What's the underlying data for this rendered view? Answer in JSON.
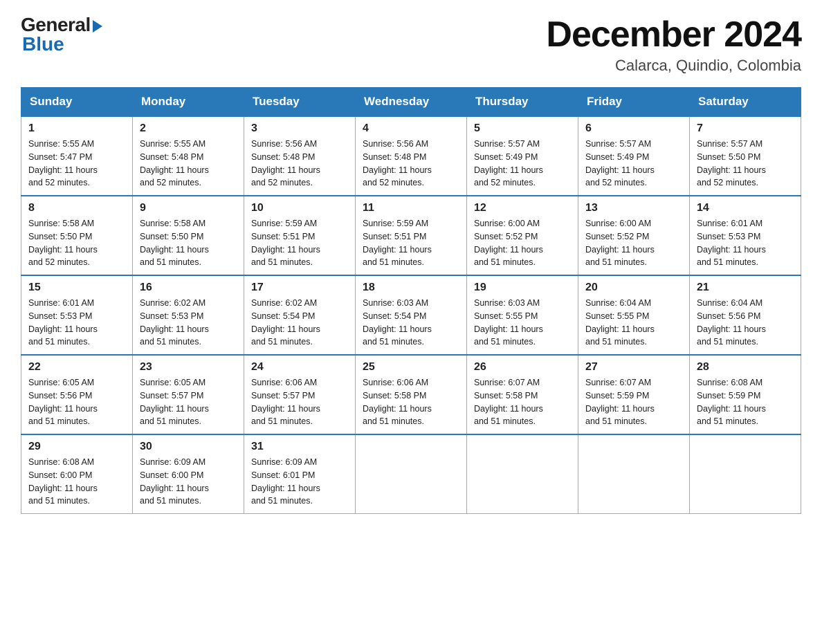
{
  "logo": {
    "general": "General",
    "blue": "Blue"
  },
  "title": {
    "month_year": "December 2024",
    "location": "Calarca, Quindio, Colombia"
  },
  "days_of_week": [
    "Sunday",
    "Monday",
    "Tuesday",
    "Wednesday",
    "Thursday",
    "Friday",
    "Saturday"
  ],
  "weeks": [
    [
      {
        "day": "1",
        "sunrise": "5:55 AM",
        "sunset": "5:47 PM",
        "daylight": "11 hours and 52 minutes."
      },
      {
        "day": "2",
        "sunrise": "5:55 AM",
        "sunset": "5:48 PM",
        "daylight": "11 hours and 52 minutes."
      },
      {
        "day": "3",
        "sunrise": "5:56 AM",
        "sunset": "5:48 PM",
        "daylight": "11 hours and 52 minutes."
      },
      {
        "day": "4",
        "sunrise": "5:56 AM",
        "sunset": "5:48 PM",
        "daylight": "11 hours and 52 minutes."
      },
      {
        "day": "5",
        "sunrise": "5:57 AM",
        "sunset": "5:49 PM",
        "daylight": "11 hours and 52 minutes."
      },
      {
        "day": "6",
        "sunrise": "5:57 AM",
        "sunset": "5:49 PM",
        "daylight": "11 hours and 52 minutes."
      },
      {
        "day": "7",
        "sunrise": "5:57 AM",
        "sunset": "5:50 PM",
        "daylight": "11 hours and 52 minutes."
      }
    ],
    [
      {
        "day": "8",
        "sunrise": "5:58 AM",
        "sunset": "5:50 PM",
        "daylight": "11 hours and 52 minutes."
      },
      {
        "day": "9",
        "sunrise": "5:58 AM",
        "sunset": "5:50 PM",
        "daylight": "11 hours and 51 minutes."
      },
      {
        "day": "10",
        "sunrise": "5:59 AM",
        "sunset": "5:51 PM",
        "daylight": "11 hours and 51 minutes."
      },
      {
        "day": "11",
        "sunrise": "5:59 AM",
        "sunset": "5:51 PM",
        "daylight": "11 hours and 51 minutes."
      },
      {
        "day": "12",
        "sunrise": "6:00 AM",
        "sunset": "5:52 PM",
        "daylight": "11 hours and 51 minutes."
      },
      {
        "day": "13",
        "sunrise": "6:00 AM",
        "sunset": "5:52 PM",
        "daylight": "11 hours and 51 minutes."
      },
      {
        "day": "14",
        "sunrise": "6:01 AM",
        "sunset": "5:53 PM",
        "daylight": "11 hours and 51 minutes."
      }
    ],
    [
      {
        "day": "15",
        "sunrise": "6:01 AM",
        "sunset": "5:53 PM",
        "daylight": "11 hours and 51 minutes."
      },
      {
        "day": "16",
        "sunrise": "6:02 AM",
        "sunset": "5:53 PM",
        "daylight": "11 hours and 51 minutes."
      },
      {
        "day": "17",
        "sunrise": "6:02 AM",
        "sunset": "5:54 PM",
        "daylight": "11 hours and 51 minutes."
      },
      {
        "day": "18",
        "sunrise": "6:03 AM",
        "sunset": "5:54 PM",
        "daylight": "11 hours and 51 minutes."
      },
      {
        "day": "19",
        "sunrise": "6:03 AM",
        "sunset": "5:55 PM",
        "daylight": "11 hours and 51 minutes."
      },
      {
        "day": "20",
        "sunrise": "6:04 AM",
        "sunset": "5:55 PM",
        "daylight": "11 hours and 51 minutes."
      },
      {
        "day": "21",
        "sunrise": "6:04 AM",
        "sunset": "5:56 PM",
        "daylight": "11 hours and 51 minutes."
      }
    ],
    [
      {
        "day": "22",
        "sunrise": "6:05 AM",
        "sunset": "5:56 PM",
        "daylight": "11 hours and 51 minutes."
      },
      {
        "day": "23",
        "sunrise": "6:05 AM",
        "sunset": "5:57 PM",
        "daylight": "11 hours and 51 minutes."
      },
      {
        "day": "24",
        "sunrise": "6:06 AM",
        "sunset": "5:57 PM",
        "daylight": "11 hours and 51 minutes."
      },
      {
        "day": "25",
        "sunrise": "6:06 AM",
        "sunset": "5:58 PM",
        "daylight": "11 hours and 51 minutes."
      },
      {
        "day": "26",
        "sunrise": "6:07 AM",
        "sunset": "5:58 PM",
        "daylight": "11 hours and 51 minutes."
      },
      {
        "day": "27",
        "sunrise": "6:07 AM",
        "sunset": "5:59 PM",
        "daylight": "11 hours and 51 minutes."
      },
      {
        "day": "28",
        "sunrise": "6:08 AM",
        "sunset": "5:59 PM",
        "daylight": "11 hours and 51 minutes."
      }
    ],
    [
      {
        "day": "29",
        "sunrise": "6:08 AM",
        "sunset": "6:00 PM",
        "daylight": "11 hours and 51 minutes."
      },
      {
        "day": "30",
        "sunrise": "6:09 AM",
        "sunset": "6:00 PM",
        "daylight": "11 hours and 51 minutes."
      },
      {
        "day": "31",
        "sunrise": "6:09 AM",
        "sunset": "6:01 PM",
        "daylight": "11 hours and 51 minutes."
      },
      null,
      null,
      null,
      null
    ]
  ],
  "labels": {
    "sunrise": "Sunrise:",
    "sunset": "Sunset:",
    "daylight": "Daylight:"
  }
}
